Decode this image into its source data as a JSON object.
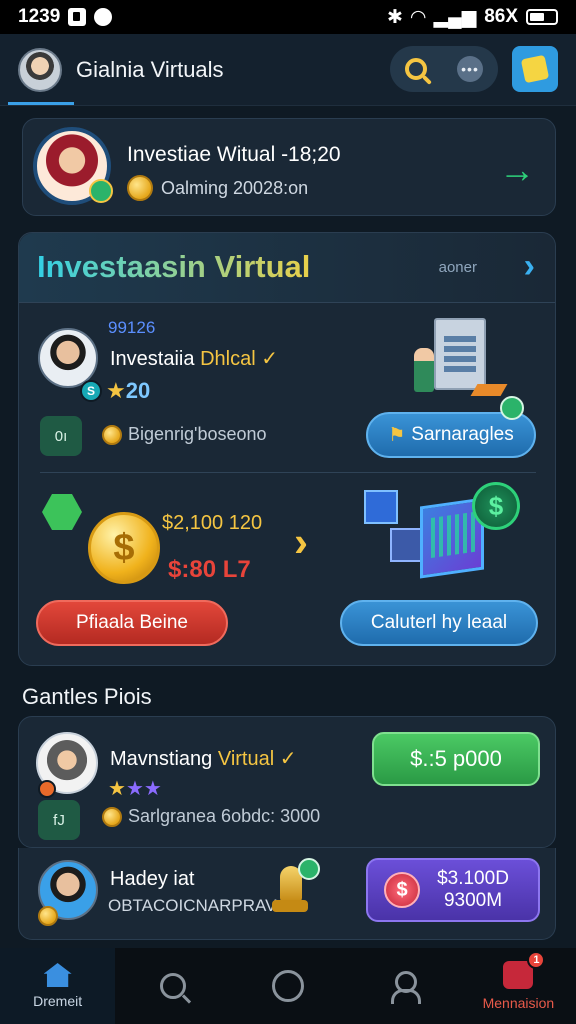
{
  "status_bar": {
    "time": "1239",
    "right_text": "86X"
  },
  "header": {
    "title": "Gialnia Virtuals"
  },
  "profile_card": {
    "title": "Investiae Witual -18;20",
    "subtitle": "Oalming 20028:on"
  },
  "invest_section": {
    "title": "Investaasin Virtual",
    "more_label": "aoner",
    "item1": {
      "id": "99126",
      "name_prefix": "Investaiia",
      "name_highlight": "Dhlcal ✓",
      "badge": "S",
      "rating_value": "20",
      "tile_label": "0ı",
      "coin_text": "Bigenrig'boseono",
      "action_label": "Sarnaragles"
    },
    "item2": {
      "amount_main": "$2,100 120",
      "amount_sub": "$:80 L7",
      "primary_action": "Pfiaala Beine",
      "secondary_action": "Caluterl hy leaal"
    }
  },
  "games_section": {
    "heading": "Gantles Piois",
    "item1": {
      "name_prefix": "Mavnstiang",
      "name_highlight": "Virtual ✓",
      "tile_label": "fJ",
      "coin_text": "Sarlgranea 6obdc: 3000",
      "button_label": "$.:5 p000"
    },
    "item2": {
      "name": "Hadey iat",
      "subtitle": "OBTACOICNARPRAV",
      "button_line1": "$3.100D",
      "button_line2": "9300M"
    }
  },
  "bottom_nav": {
    "items": [
      {
        "label": "Dremeit",
        "icon": "home-icon"
      },
      {
        "label": "",
        "icon": "search-icon"
      },
      {
        "label": "",
        "icon": "circle-icon"
      },
      {
        "label": "",
        "icon": "person-icon"
      },
      {
        "label": "Mennaision",
        "icon": "profile-icon",
        "badge": "1"
      }
    ]
  },
  "colors": {
    "accent_blue": "#3a93d6",
    "accent_gold": "#f5c542",
    "accent_green": "#2ed17a",
    "accent_red": "#e2473a",
    "accent_purple": "#6b4fd8"
  }
}
